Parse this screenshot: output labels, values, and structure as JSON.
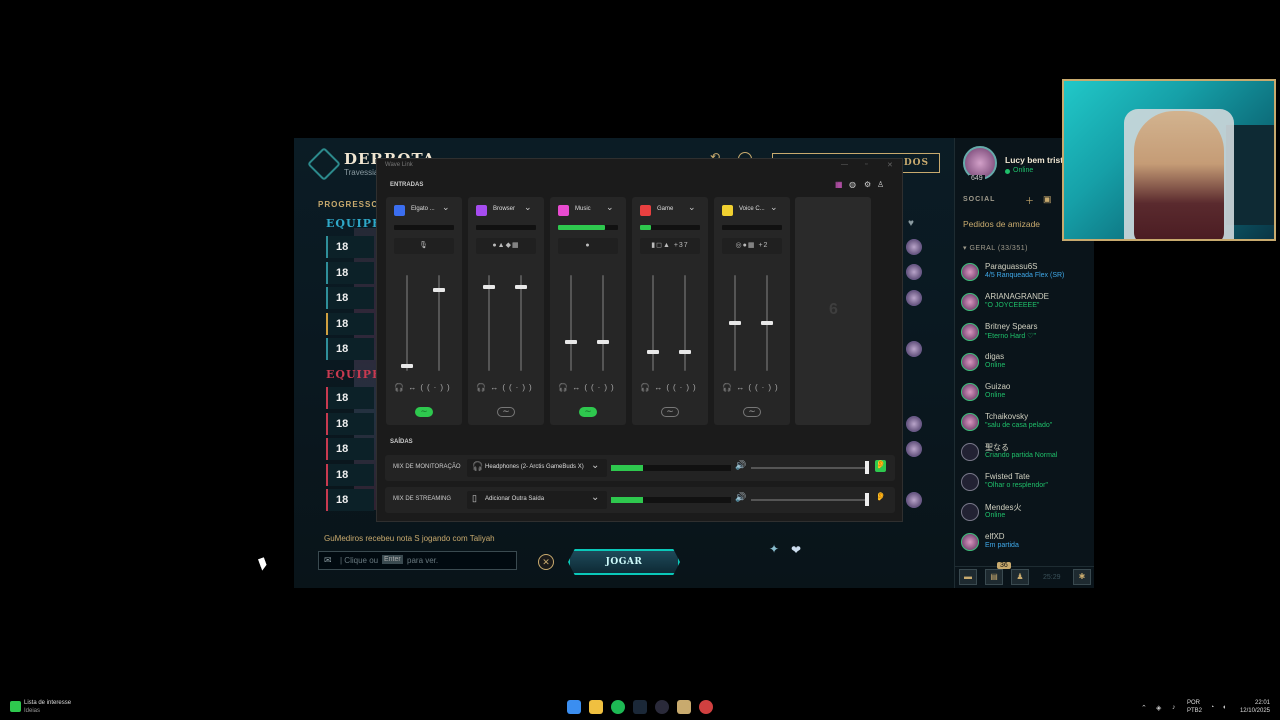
{
  "client": {
    "title": "DERROTA",
    "subtitle": "Travessia",
    "progress_label": "PROGRESSO",
    "team1_label": "EQUIPE 1",
    "team2_label": "EQUIPE 2",
    "top_button": "ADOS",
    "team1_levels": [
      "18",
      "18",
      "18",
      "18",
      "18"
    ],
    "team2_levels": [
      "18",
      "18",
      "18",
      "18",
      "18"
    ],
    "notice": "GuMediros recebeu nota S jogando com Taliyah",
    "chat_placeholder_pre": "| Clique ou",
    "chat_key": "Enter",
    "chat_placeholder_post": "para ver.",
    "play_again": "JOGAR NOVAMENTE"
  },
  "social": {
    "username": "Lucy bem trist",
    "user_status": "Online",
    "user_level": "649",
    "section_label": "SOCIAL",
    "friend_requests": "Pedidos de amizade",
    "group_label": "▾ GERAL (33/351)",
    "friends": [
      {
        "name": "Paraguassu6S",
        "status": "4/5 Ranqueada Flex (SR)"
      },
      {
        "name": "ARIANAGRANDE",
        "status": "\"O JOYCEEEEE\""
      },
      {
        "name": "Britney Spears",
        "status": "\"Eterno Hard ♡\""
      },
      {
        "name": "digas",
        "status": "Online"
      },
      {
        "name": "Guizao",
        "status": "Online"
      },
      {
        "name": "Tchaikovsky",
        "status": "\"salu de casa pelado\""
      },
      {
        "name": "聖なる",
        "status": "Criando partida Normal"
      },
      {
        "name": "Fwisted Tate",
        "status": "\"Olhar o resplendor\""
      },
      {
        "name": "Mendes火",
        "status": "Online"
      },
      {
        "name": "elfXD",
        "status": "Em partida"
      }
    ],
    "badge_count": "36",
    "clock": "25:29"
  },
  "wave": {
    "window_title": "Wave Link",
    "inputs_label": "ENTRADAS",
    "outputs_label": "SAÍDAS",
    "channels": [
      {
        "name": "Elgato ...",
        "color": "#3b6ef0",
        "meter": 0.0,
        "sources": "🎙",
        "left": 0.05,
        "right": 0.84,
        "monitor_on": true
      },
      {
        "name": "Browser",
        "color": "#a64cf0",
        "meter": 0.0,
        "sources": "●▲◆▦",
        "left": 0.88,
        "right": 0.88,
        "monitor_on": false
      },
      {
        "name": "Music",
        "color": "#e84bd0",
        "meter": 0.78,
        "sources": "●",
        "left": 0.3,
        "right": 0.3,
        "monitor_on": true
      },
      {
        "name": "Game",
        "color": "#e84040",
        "meter": 0.18,
        "sources": "▮◻▲ +37",
        "left": 0.2,
        "right": 0.2,
        "monitor_on": false
      },
      {
        "name": "Voice C...",
        "color": "#f0d030",
        "meter": 0.0,
        "sources": "◎●▦ +2",
        "left": 0.5,
        "right": 0.5,
        "monitor_on": false
      }
    ],
    "empty_slot_number": "6",
    "outputs": [
      {
        "label": "MIX DE MONITORAÇÃO",
        "device": "Headphones (2- Arctis GameBuds X)",
        "meter": 0.27,
        "volume": 1.0,
        "listen_on": true
      },
      {
        "label": "MIX DE STREAMING",
        "device": "Adicionar Outra Saída",
        "meter": 0.27,
        "volume": 1.0,
        "listen_on": false
      }
    ]
  },
  "taskbar": {
    "widget_title": "Lista de interesse",
    "widget_sub": "Ideias",
    "lang": "POR",
    "lang2": "PTB2",
    "time": "22:01",
    "date": "12/10/2025"
  },
  "colors": {
    "accent_gold": "#c8aa6e",
    "accent_teal": "#0ac8b9",
    "green": "#2ec84e"
  }
}
